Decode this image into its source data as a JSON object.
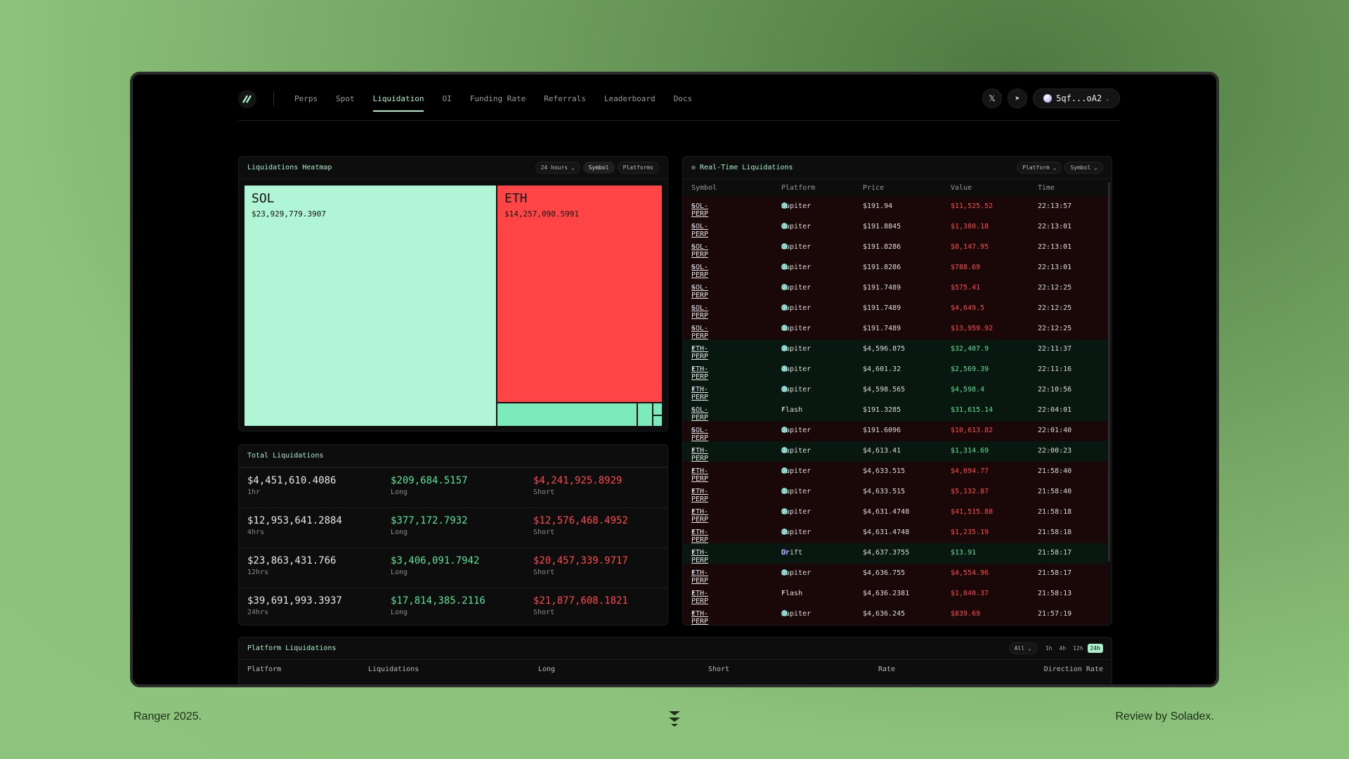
{
  "nav": {
    "links": [
      "Perps",
      "Spot",
      "Liquidation",
      "OI",
      "Funding Rate",
      "Referrals",
      "Leaderboard",
      "Docs"
    ],
    "active": "Liquidation",
    "wallet": "5qf...oA2"
  },
  "heatmap": {
    "title": "Liquidations Heatmap",
    "range": "24 hours",
    "chip_symbol": "Symbol",
    "chip_platforms": "Platforms",
    "tiles": [
      {
        "symbol": "SOL",
        "amount": "$23,929,779.3907",
        "color": "#b0f5d6"
      },
      {
        "symbol": "ETH",
        "amount": "$14,257,090.5991",
        "color": "#ff4545"
      }
    ]
  },
  "totals": {
    "title": "Total Liquidations",
    "rows": [
      {
        "total": "$4,451,610.4086",
        "period": "1hr",
        "long": "$209,684.5157",
        "short": "$4,241,925.8929"
      },
      {
        "total": "$12,953,641.2884",
        "period": "4hrs",
        "long": "$377,172.7932",
        "short": "$12,576,468.4952"
      },
      {
        "total": "$23,863,431.766",
        "period": "12hrs",
        "long": "$3,406,091.7942",
        "short": "$20,457,339.9717"
      },
      {
        "total": "$39,691,993.3937",
        "period": "24hrs",
        "long": "$17,814,385.2116",
        "short": "$21,877,608.1821"
      }
    ],
    "long_label": "Long",
    "short_label": "Short"
  },
  "realtime": {
    "title": "Real-Time Liquidations",
    "chip_platform": "Platform",
    "chip_symbol": "Symbol",
    "columns": [
      "Symbol",
      "Platform",
      "Price",
      "Value",
      "Time"
    ],
    "rows": [
      {
        "symbol": "SOL-PERP",
        "platform": "Jupiter",
        "price": "$191.94",
        "value": "$11,525.52",
        "time": "22:13:57",
        "side": "short"
      },
      {
        "symbol": "SOL-PERP",
        "platform": "Jupiter",
        "price": "$191.8845",
        "value": "$1,380.18",
        "time": "22:13:01",
        "side": "short"
      },
      {
        "symbol": "SOL-PERP",
        "platform": "Jupiter",
        "price": "$191.8286",
        "value": "$8,147.95",
        "time": "22:13:01",
        "side": "short"
      },
      {
        "symbol": "SOL-PERP",
        "platform": "Jupiter",
        "price": "$191.8286",
        "value": "$788.69",
        "time": "22:13:01",
        "side": "short"
      },
      {
        "symbol": "SOL-PERP",
        "platform": "Jupiter",
        "price": "$191.7489",
        "value": "$575.41",
        "time": "22:12:25",
        "side": "short"
      },
      {
        "symbol": "SOL-PERP",
        "platform": "Jupiter",
        "price": "$191.7489",
        "value": "$4,649.5",
        "time": "22:12:25",
        "side": "short"
      },
      {
        "symbol": "SOL-PERP",
        "platform": "Jupiter",
        "price": "$191.7489",
        "value": "$13,959.92",
        "time": "22:12:25",
        "side": "short"
      },
      {
        "symbol": "ETH-PERP",
        "platform": "Jupiter",
        "price": "$4,596.875",
        "value": "$32,407.9",
        "time": "22:11:37",
        "side": "long"
      },
      {
        "symbol": "ETH-PERP",
        "platform": "Jupiter",
        "price": "$4,601.32",
        "value": "$2,569.39",
        "time": "22:11:16",
        "side": "long"
      },
      {
        "symbol": "ETH-PERP",
        "platform": "Jupiter",
        "price": "$4,598.565",
        "value": "$4,598.4",
        "time": "22:10:56",
        "side": "long"
      },
      {
        "symbol": "SOL-PERP",
        "platform": "Flash",
        "price": "$191.3285",
        "value": "$31,615.14",
        "time": "22:04:01",
        "side": "long"
      },
      {
        "symbol": "SOL-PERP",
        "platform": "Jupiter",
        "price": "$191.6096",
        "value": "$10,613.82",
        "time": "22:01:40",
        "side": "short"
      },
      {
        "symbol": "ETH-PERP",
        "platform": "Jupiter",
        "price": "$4,613.41",
        "value": "$1,314.69",
        "time": "22:00:23",
        "side": "long"
      },
      {
        "symbol": "ETH-PERP",
        "platform": "Jupiter",
        "price": "$4,633.515",
        "value": "$4,094.77",
        "time": "21:58:40",
        "side": "short"
      },
      {
        "symbol": "ETH-PERP",
        "platform": "Jupiter",
        "price": "$4,633.515",
        "value": "$5,132.87",
        "time": "21:58:40",
        "side": "short"
      },
      {
        "symbol": "ETH-PERP",
        "platform": "Jupiter",
        "price": "$4,631.4748",
        "value": "$41,515.88",
        "time": "21:58:18",
        "side": "short"
      },
      {
        "symbol": "ETH-PERP",
        "platform": "Jupiter",
        "price": "$4,631.4748",
        "value": "$1,235.19",
        "time": "21:58:18",
        "side": "short"
      },
      {
        "symbol": "ETH-PERP",
        "platform": "Drift",
        "price": "$4,637.3755",
        "value": "$13.91",
        "time": "21:58:17",
        "side": "long"
      },
      {
        "symbol": "ETH-PERP",
        "platform": "Jupiter",
        "price": "$4,636.755",
        "value": "$4,554.96",
        "time": "21:58:17",
        "side": "short"
      },
      {
        "symbol": "ETH-PERP",
        "platform": "Flash",
        "price": "$4,636.2381",
        "value": "$1,840.37",
        "time": "21:58:13",
        "side": "short"
      },
      {
        "symbol": "ETH-PERP",
        "platform": "Jupiter",
        "price": "$4,636.245",
        "value": "$839.69",
        "time": "21:57:19",
        "side": "short"
      }
    ]
  },
  "platform": {
    "title": "Platform Liquidations",
    "filter": "All",
    "timeframes": [
      "1h",
      "4h",
      "12h",
      "24h"
    ],
    "active_timeframe": "24h",
    "columns": [
      "Platform",
      "Liquidations",
      "Long",
      "Short",
      "Rate",
      "Direction Rate"
    ]
  },
  "footer": {
    "left": "Ranger 2025.",
    "right": "Review by Soladex."
  },
  "colors": {
    "accent": "#a8f0c8",
    "long": "#58e39a",
    "short": "#ff4a4a"
  }
}
